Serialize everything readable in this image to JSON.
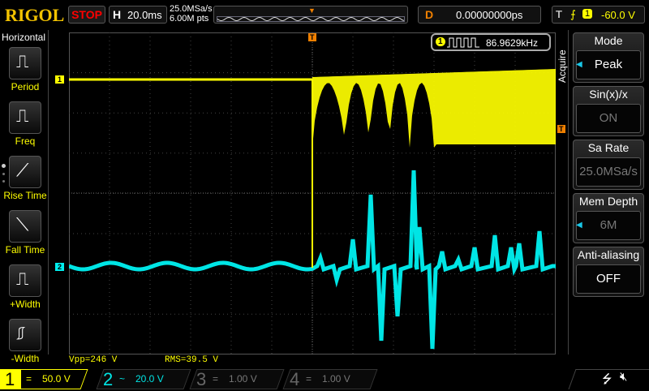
{
  "header": {
    "brand": "RIGOL",
    "run_state": "STOP",
    "timebase_label": "H",
    "timebase": "20.0ms",
    "sample_rate": "25.0MSa/s",
    "mem_pts": "6.00M pts",
    "delay_label": "D",
    "delay": "0.00000000ps",
    "trigger_label": "T",
    "trigger_source": "1",
    "trigger_level": "-60.0 V"
  },
  "left_menu": {
    "title": "Horizontal",
    "items": [
      {
        "label": "Period"
      },
      {
        "label": "Freq"
      },
      {
        "label": "Rise Time"
      },
      {
        "label": "Fall Time"
      },
      {
        "label": "+Width"
      },
      {
        "label": "-Width"
      }
    ]
  },
  "frequency_counter": {
    "channel": "1",
    "value": "86.9629kHz"
  },
  "right_menu": {
    "title": "Acquire",
    "items": [
      {
        "label": "Mode",
        "value": "Peak"
      },
      {
        "label": "Sin(x)/x",
        "value": "ON"
      },
      {
        "label": "Sa Rate",
        "value": "25.0MSa/s"
      },
      {
        "label": "Mem Depth",
        "value": "6M"
      },
      {
        "label": "Anti-aliasing",
        "value": "OFF"
      }
    ]
  },
  "measurements": {
    "vpp": "Vpp=246 V",
    "rms": "RMS=39.5 V"
  },
  "channels": [
    {
      "num": "1",
      "coupling": "=",
      "scale": "50.0 V",
      "color": "#ffff00"
    },
    {
      "num": "2",
      "coupling": "~",
      "scale": "20.0 V",
      "color": "#00e5e5"
    },
    {
      "num": "3",
      "coupling": "=",
      "scale": "1.00 V",
      "color": "#c000c0"
    },
    {
      "num": "4",
      "coupling": "=",
      "scale": "1.00 V",
      "color": "#3060c0"
    }
  ],
  "markers": {
    "ch1": "1",
    "ch2": "2",
    "trigger": "T"
  }
}
